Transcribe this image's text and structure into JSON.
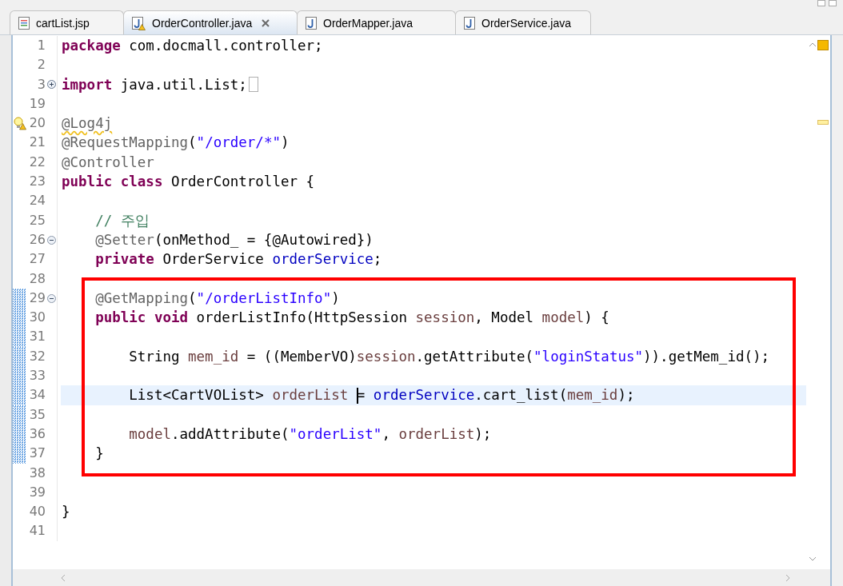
{
  "tabs": [
    {
      "label": "cartList.jsp",
      "kind": "jsp",
      "selected": false,
      "warning": false
    },
    {
      "label": "OrderController.java",
      "kind": "java",
      "selected": true,
      "warning": true
    },
    {
      "label": "OrderMapper.java",
      "kind": "java",
      "selected": false,
      "warning": false
    },
    {
      "label": "OrderService.java",
      "kind": "java",
      "selected": false,
      "warning": false
    }
  ],
  "lines": [
    {
      "number": "1",
      "kind": "plain",
      "changed": false,
      "current": false,
      "tokens": [
        {
          "kind": "keyword",
          "text": "package"
        },
        {
          "kind": "plain",
          "text": " com.docmall.controller;"
        }
      ]
    },
    {
      "number": "2",
      "kind": "plain",
      "changed": false,
      "current": false
    },
    {
      "number": "3",
      "kind": "expand",
      "changed": false,
      "current": false,
      "tokens": [
        {
          "kind": "keyword",
          "text": "import"
        },
        {
          "kind": "plain",
          "text": " java.util.List;"
        }
      ]
    },
    {
      "number": "19",
      "kind": "plain",
      "changed": false,
      "current": false
    },
    {
      "number": "20",
      "kind": "warning",
      "changed": false,
      "current": false,
      "tokens": [
        {
          "kind": "warned_annotation",
          "text": "@Log4j"
        }
      ]
    },
    {
      "number": "21",
      "kind": "plain",
      "changed": false,
      "current": false,
      "tokens": [
        {
          "kind": "annotation",
          "text": "@RequestMapping"
        },
        {
          "kind": "plain",
          "text": "("
        },
        {
          "kind": "string",
          "text": "\"/order/*\""
        },
        {
          "kind": "plain",
          "text": ")"
        }
      ]
    },
    {
      "number": "22",
      "kind": "plain",
      "changed": false,
      "current": false,
      "tokens": [
        {
          "kind": "annotation",
          "text": "@Controller"
        }
      ]
    },
    {
      "number": "23",
      "kind": "plain",
      "changed": false,
      "current": false,
      "tokens": [
        {
          "kind": "keyword",
          "text": "public class"
        },
        {
          "kind": "plain",
          "text": " OrderController {"
        }
      ]
    },
    {
      "number": "24",
      "kind": "plain",
      "changed": false,
      "current": false
    },
    {
      "number": "25",
      "kind": "plain",
      "changed": false,
      "current": false,
      "tokens": [
        {
          "kind": "comment",
          "text": "    // 주입"
        }
      ]
    },
    {
      "number": "26",
      "kind": "collapse",
      "changed": false,
      "current": false,
      "tokens": [
        {
          "kind": "annotation",
          "text": "    @Setter"
        },
        {
          "kind": "plain",
          "text": "(onMethod_ = {@Autowired})"
        }
      ]
    },
    {
      "number": "27",
      "kind": "plain",
      "changed": false,
      "current": false,
      "tokens": [
        {
          "kind": "keyword",
          "text": "    private"
        },
        {
          "kind": "plain",
          "text": " OrderService "
        },
        {
          "kind": "field",
          "text": "orderService"
        },
        {
          "kind": "plain",
          "text": ";"
        }
      ]
    },
    {
      "number": "28",
      "kind": "plain",
      "changed": false,
      "current": false
    },
    {
      "number": "29",
      "kind": "collapse",
      "changed": true,
      "current": false,
      "tokens": [
        {
          "kind": "annotation",
          "text": "    @GetMapping"
        },
        {
          "kind": "plain",
          "text": "("
        },
        {
          "kind": "string",
          "text": "\"/orderListInfo\""
        },
        {
          "kind": "plain",
          "text": ")"
        }
      ]
    },
    {
      "number": "30",
      "kind": "plain",
      "changed": true,
      "current": false,
      "tokens": [
        {
          "kind": "keyword",
          "text": "    public void"
        },
        {
          "kind": "plain",
          "text": " orderListInfo(HttpSession "
        },
        {
          "kind": "local",
          "text": "session"
        },
        {
          "kind": "plain",
          "text": ", Model "
        },
        {
          "kind": "local",
          "text": "model"
        },
        {
          "kind": "plain",
          "text": ") {"
        }
      ]
    },
    {
      "number": "31",
      "kind": "plain",
      "changed": true,
      "current": false
    },
    {
      "number": "32",
      "kind": "plain",
      "changed": true,
      "current": false,
      "tokens": [
        {
          "kind": "plain",
          "text": "        String "
        },
        {
          "kind": "local",
          "text": "mem_id"
        },
        {
          "kind": "plain",
          "text": " = ((MemberVO)"
        },
        {
          "kind": "local",
          "text": "session"
        },
        {
          "kind": "plain",
          "text": ".getAttribute("
        },
        {
          "kind": "string",
          "text": "\"loginStatus\""
        },
        {
          "kind": "plain",
          "text": ")).getMem_id();"
        }
      ]
    },
    {
      "number": "33",
      "kind": "plain",
      "changed": true,
      "current": false
    },
    {
      "number": "34",
      "kind": "plain",
      "changed": true,
      "current": true,
      "tokens": [
        {
          "kind": "plain",
          "text": "        List<CartVOList> "
        },
        {
          "kind": "local",
          "text": "orderList "
        },
        {
          "kind": "plain",
          "text": "= ",
          "caret": true
        },
        {
          "kind": "field",
          "text": "orderService"
        },
        {
          "kind": "plain",
          "text": ".cart_list("
        },
        {
          "kind": "local",
          "text": "mem_id"
        },
        {
          "kind": "plain",
          "text": ");"
        }
      ]
    },
    {
      "number": "35",
      "kind": "plain",
      "changed": true,
      "current": false
    },
    {
      "number": "36",
      "kind": "plain",
      "changed": true,
      "current": false,
      "tokens": [
        {
          "kind": "local",
          "text": "        model"
        },
        {
          "kind": "plain",
          "text": ".addAttribute("
        },
        {
          "kind": "string",
          "text": "\"orderList\""
        },
        {
          "kind": "plain",
          "text": ", "
        },
        {
          "kind": "local",
          "text": "orderList"
        },
        {
          "kind": "plain",
          "text": ");"
        }
      ]
    },
    {
      "number": "37",
      "kind": "plain",
      "changed": true,
      "current": false,
      "tokens": [
        {
          "kind": "plain",
          "text": "    }"
        }
      ]
    },
    {
      "number": "38",
      "kind": "plain",
      "changed": false,
      "current": false
    },
    {
      "number": "39",
      "kind": "plain",
      "changed": false,
      "current": false
    },
    {
      "number": "40",
      "kind": "plain",
      "changed": false,
      "current": false,
      "tokens": [
        {
          "kind": "plain",
          "text": "}"
        }
      ]
    },
    {
      "number": "41",
      "kind": "plain",
      "changed": false,
      "current": false
    }
  ]
}
